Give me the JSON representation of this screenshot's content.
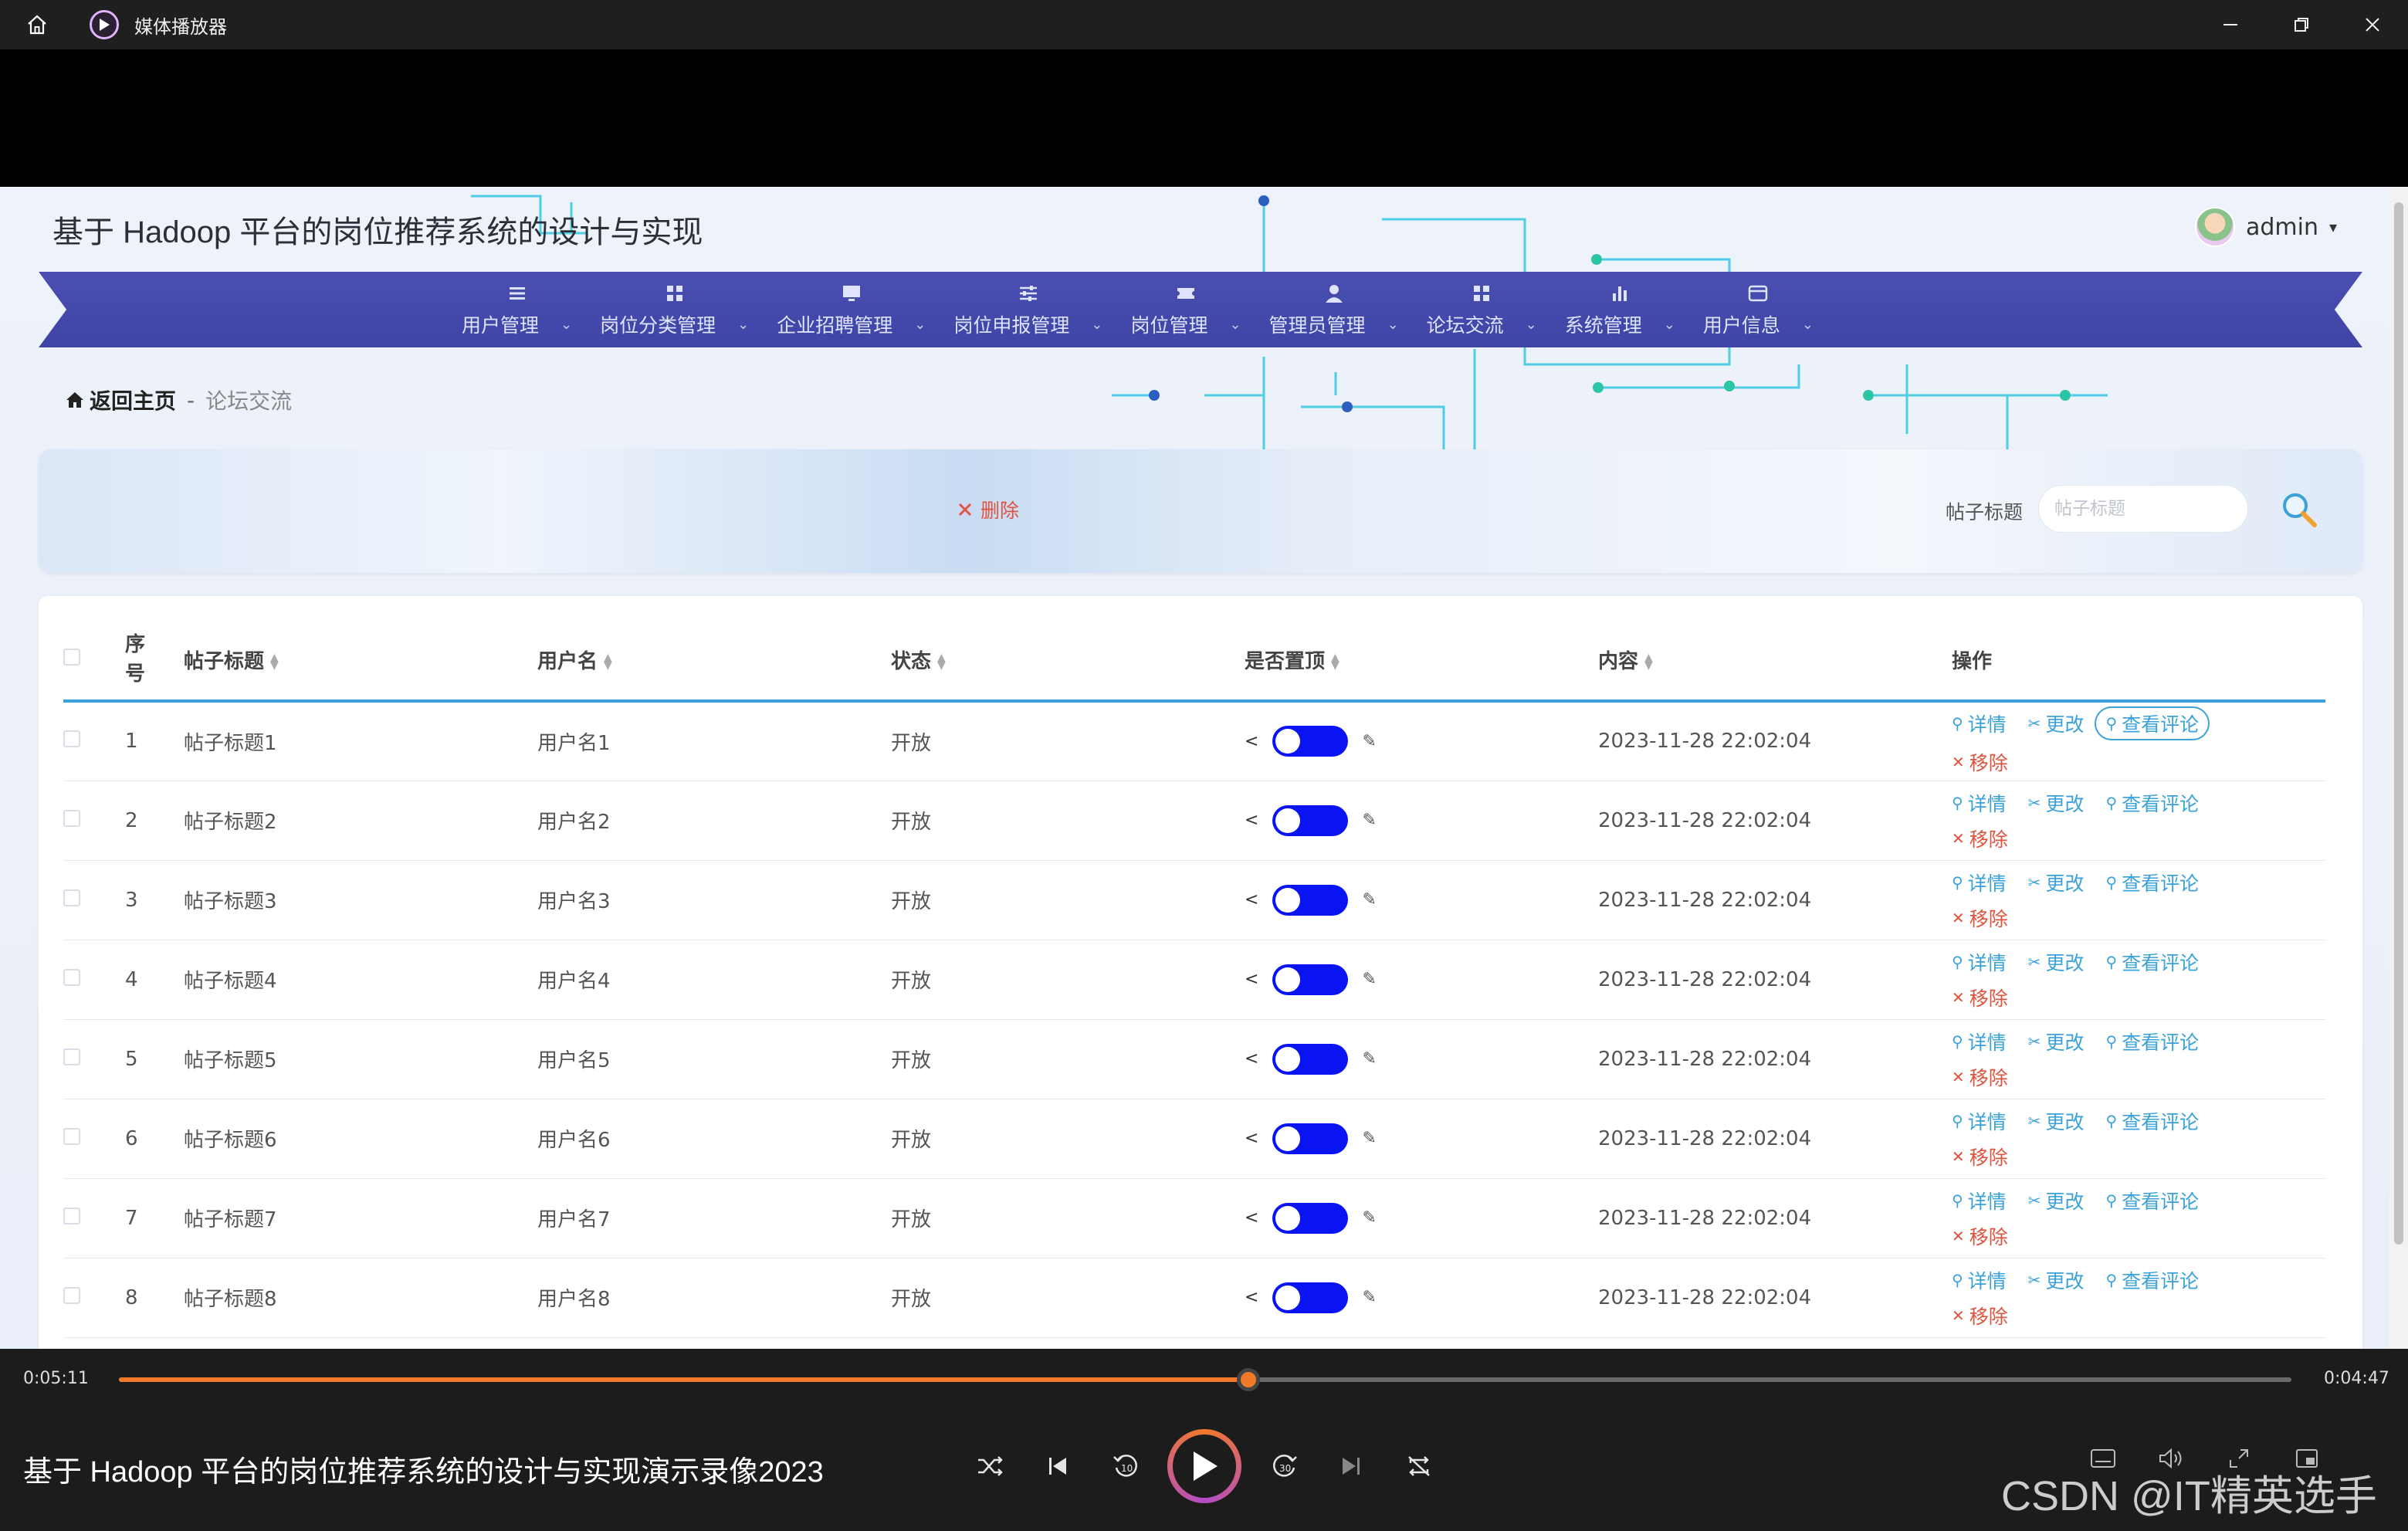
{
  "window": {
    "title": "媒体播放器"
  },
  "site": {
    "title": "基于 Hadoop 平台的岗位推荐系统的设计与实现",
    "user": "admin"
  },
  "nav": [
    {
      "label": "用户管理",
      "icon": "list-icon"
    },
    {
      "label": "岗位分类管理",
      "icon": "grid-icon"
    },
    {
      "label": "企业招聘管理",
      "icon": "monitor-icon"
    },
    {
      "label": "岗位申报管理",
      "icon": "sliders-icon"
    },
    {
      "label": "岗位管理",
      "icon": "ticket-icon"
    },
    {
      "label": "管理员管理",
      "icon": "user-icon"
    },
    {
      "label": "论坛交流",
      "icon": "grid-icon"
    },
    {
      "label": "系统管理",
      "icon": "bar-chart-icon"
    },
    {
      "label": "用户信息",
      "icon": "card-icon"
    }
  ],
  "breadcrumb": {
    "home": "返回主页",
    "sep": "-",
    "current": "论坛交流"
  },
  "toolbar": {
    "delete_label": "删除",
    "search_label": "帖子标题",
    "search_placeholder": "帖子标题"
  },
  "table": {
    "headers": {
      "seq": "序号",
      "seq_top": "序",
      "seq_bottom": "号",
      "title": "帖子标题",
      "user": "用户名",
      "status": "状态",
      "top": "是否置顶",
      "content": "内容",
      "ops": "操作"
    },
    "ops": {
      "detail": "详情",
      "edit": "更改",
      "comments": "查看评论",
      "remove": "移除"
    },
    "rows": [
      {
        "seq": "1",
        "title": "帖子标题1",
        "user": "用户名1",
        "status": "开放",
        "pinned": true,
        "content": "2023-11-28 22:02:04"
      },
      {
        "seq": "2",
        "title": "帖子标题2",
        "user": "用户名2",
        "status": "开放",
        "pinned": true,
        "content": "2023-11-28 22:02:04"
      },
      {
        "seq": "3",
        "title": "帖子标题3",
        "user": "用户名3",
        "status": "开放",
        "pinned": true,
        "content": "2023-11-28 22:02:04"
      },
      {
        "seq": "4",
        "title": "帖子标题4",
        "user": "用户名4",
        "status": "开放",
        "pinned": true,
        "content": "2023-11-28 22:02:04"
      },
      {
        "seq": "5",
        "title": "帖子标题5",
        "user": "用户名5",
        "status": "开放",
        "pinned": true,
        "content": "2023-11-28 22:02:04"
      },
      {
        "seq": "6",
        "title": "帖子标题6",
        "user": "用户名6",
        "status": "开放",
        "pinned": true,
        "content": "2023-11-28 22:02:04"
      },
      {
        "seq": "7",
        "title": "帖子标题7",
        "user": "用户名7",
        "status": "开放",
        "pinned": true,
        "content": "2023-11-28 22:02:04"
      },
      {
        "seq": "8",
        "title": "帖子标题8",
        "user": "用户名8",
        "status": "开放",
        "pinned": true,
        "content": "2023-11-28 22:02:04"
      }
    ]
  },
  "player": {
    "elapsed": "0:05:11",
    "remaining": "0:04:47",
    "progress_fraction": 0.52,
    "video_title": "基于 Hadoop 平台的岗位推荐系统的设计与实现演示录像2023",
    "watermark": "CSDN @IT精英选手"
  },
  "colors": {
    "accent": "#3aa2d8",
    "nav": "#3e45a6",
    "toggle": "#0a13f2",
    "danger": "#e0533f",
    "progress": "#f07a2a"
  }
}
